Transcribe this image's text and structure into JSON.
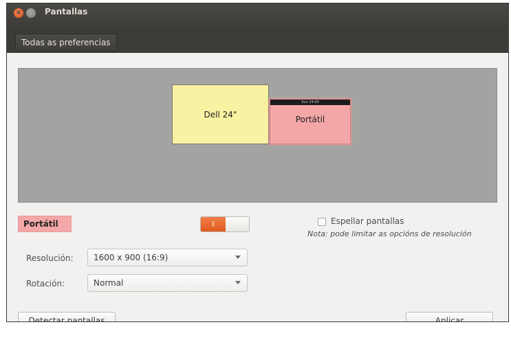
{
  "window": {
    "title": "Pantallas",
    "close_glyph": "×"
  },
  "toolbar": {
    "all_settings_label": "Todas as preferencias"
  },
  "arrangement": {
    "monitors": [
      {
        "name": "Dell 24\"",
        "color": "#f8f2a2"
      },
      {
        "name": "Portátil",
        "color": "#f4a7a7",
        "topbar_text": "Sun 14:00"
      }
    ]
  },
  "display": {
    "selected_name": "Portátil",
    "power_toggle": {
      "state": "on",
      "on_label": "I"
    },
    "resolution": {
      "label": "Resolución:",
      "value": "1600 x 900 (16:9)"
    },
    "rotation": {
      "label": "Rotación:",
      "value": "Normal"
    }
  },
  "mirror": {
    "label": "Espellar pantallas",
    "checked": false,
    "note": "Nota: pode limitar as opcións de resolución"
  },
  "buttons": {
    "detect_label": "Detectar pantallas",
    "apply_label": "Aplicar"
  },
  "colors": {
    "accent": "#e05a1e",
    "titlebar": "#3c3b37",
    "arrangement_bg": "#a3a3a1"
  },
  "icons": {
    "close": "close-icon",
    "minimize": "minimize-icon",
    "dropdown": "chevron-down-icon"
  }
}
